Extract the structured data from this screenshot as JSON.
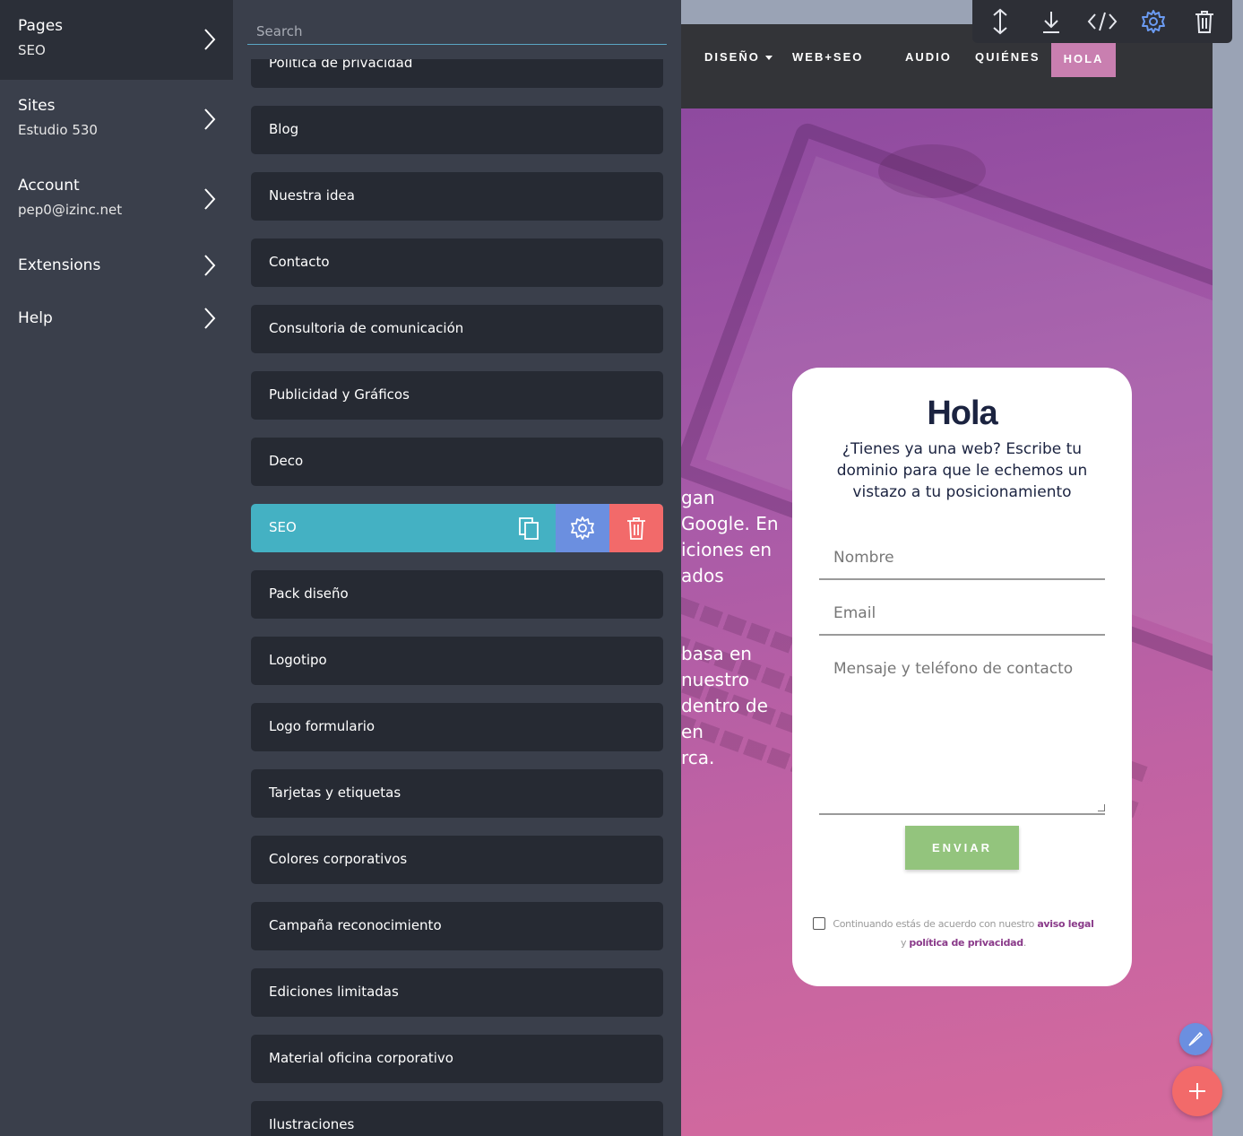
{
  "sidebar": {
    "items": [
      {
        "title": "Pages",
        "sub": "SEO"
      },
      {
        "title": "Sites",
        "sub": "Estudio 530"
      },
      {
        "title": "Account",
        "sub": "pep0@izinc.net"
      },
      {
        "title": "Extensions",
        "sub": ""
      },
      {
        "title": "Help",
        "sub": ""
      }
    ]
  },
  "pages_panel": {
    "search_placeholder": "Search",
    "pages": [
      "Política de privacidad",
      "Blog",
      "Nuestra idea",
      "Contacto",
      "Consultoria de comunicación",
      "Publicidad y Gráficos",
      "Deco",
      "SEO",
      "Pack diseño",
      "Logotipo",
      "Logo formulario",
      "Tarjetas y etiquetas",
      "Colores corporativos",
      "Campaña reconocimiento",
      "Ediciones limitadas",
      "Material oficina corporativo",
      "Ilustraciones"
    ],
    "selected": "SEO",
    "selected_actions": [
      "copy-icon",
      "gear-icon",
      "trash-icon"
    ]
  },
  "toolbar": {
    "icons": [
      "move-vertical-icon",
      "download-icon",
      "code-icon",
      "gear-icon",
      "trash-icon"
    ]
  },
  "site": {
    "nav": {
      "diseno": "DISEÑO",
      "webseo": "WEB+SEO",
      "audio": "AUDIO",
      "quienes": "QUIÉNES",
      "hola": "HOLA"
    },
    "hero_lines_1": [
      "gan",
      "Google. En",
      "iciones en",
      "ados"
    ],
    "hero_lines_2": [
      "basa en",
      "nuestro",
      "dentro de",
      "en",
      "rca."
    ],
    "form": {
      "title": "Hola",
      "subtitle": "¿Tienes ya una web? Escribe tu dominio para que le echemos un vistazo a tu posicionamiento",
      "name_placeholder": "Nombre",
      "email_placeholder": "Email",
      "message_placeholder": "Mensaje y teléfono de contacto",
      "send_label": "ENVIAR",
      "legal_prefix": "Continuando estás de acuerdo con nuestro",
      "legal_link_1": "aviso legal",
      "legal_mid": "y",
      "legal_link_2": "política de privacidad",
      "legal_suffix": "."
    }
  },
  "colors": {
    "panel_bg": "#3a3f4b",
    "item_bg": "#262a33",
    "selected_bg": "#44b1c3",
    "gear_bg": "#6b8fe0",
    "delete_bg": "#f26a6a",
    "nav_active": "#c97fb0",
    "send_button": "#93c47d"
  }
}
